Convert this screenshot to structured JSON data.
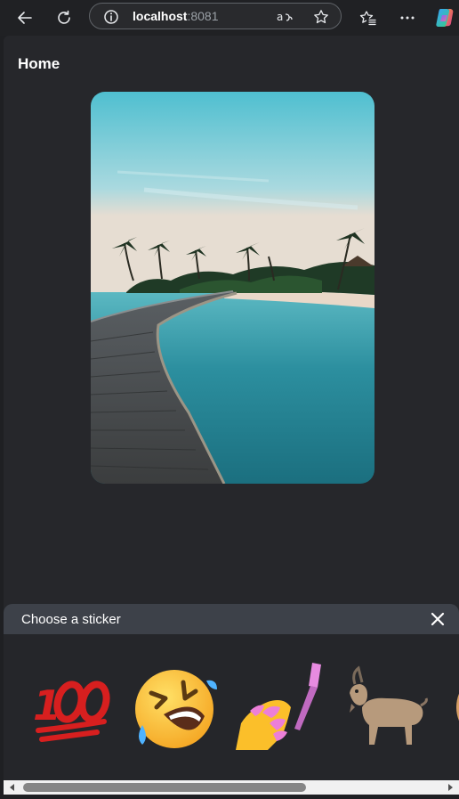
{
  "browser": {
    "url_host": "localhost",
    "url_port": ":8081",
    "icons": [
      "back-arrow-icon",
      "reload-icon",
      "info-icon",
      "read-aloud-icon",
      "star-icon",
      "favorites-icon",
      "more-icon",
      "copilot-icon"
    ]
  },
  "page": {
    "title": "Home",
    "photo_icon": "tropical-boardwalk-photo"
  },
  "sticker_sheet": {
    "title": "Choose a sticker",
    "close_icon": "close-icon",
    "stickers": [
      {
        "name": "hundred-points",
        "emoji": "💯"
      },
      {
        "name": "rolling-laughing",
        "emoji": "🤣"
      },
      {
        "name": "nail-polish",
        "emoji": "💅"
      },
      {
        "name": "goat",
        "emoji": "🐐"
      },
      {
        "name": "donut",
        "emoji": "🍩"
      }
    ]
  },
  "colors": {
    "page_bg": "#26272b",
    "sheet_header": "#3d4149",
    "chrome_bg": "#202124"
  }
}
